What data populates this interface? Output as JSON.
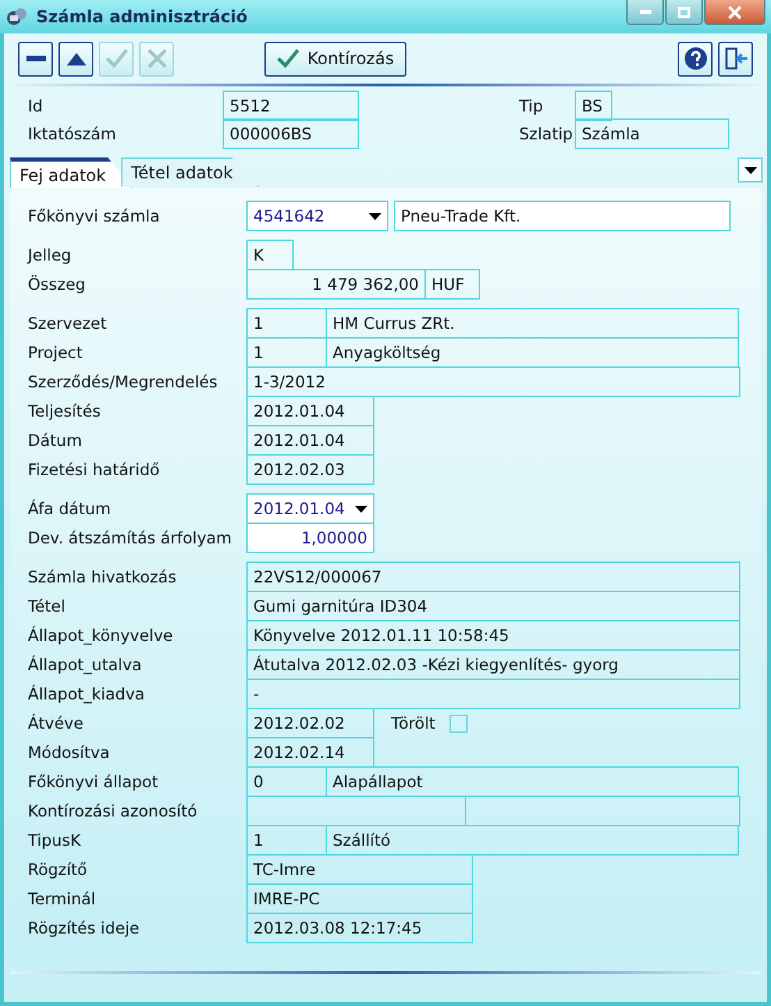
{
  "window": {
    "title": "Számla adminisztráció"
  },
  "toolbar": {
    "left_buttons": [
      {
        "kind": "minus",
        "disabled": false
      },
      {
        "kind": "up",
        "disabled": false
      },
      {
        "kind": "check",
        "disabled": true
      },
      {
        "kind": "cross",
        "disabled": true
      }
    ],
    "center_button": {
      "label": "Kontírozás",
      "disabled": false
    },
    "right_buttons": [
      {
        "kind": "help",
        "disabled": false
      },
      {
        "kind": "exit",
        "disabled": false
      }
    ]
  },
  "header": {
    "left": [
      {
        "label": "Id",
        "value": "5512"
      },
      {
        "label": "Iktatószám",
        "value": "000006BS"
      }
    ],
    "right": [
      {
        "label": "Tip",
        "value": "BS",
        "kind": "short"
      },
      {
        "label": "Szlatip",
        "value": "Számla",
        "kind": "wide"
      }
    ]
  },
  "tabs": [
    {
      "label": "Fej adatok",
      "selected": true
    },
    {
      "label": "Tétel adatok",
      "selected": false
    }
  ],
  "form": {
    "groups": [
      [
        {
          "label": "Főkönyvi számla",
          "kind": "combo-text",
          "editable": true,
          "values": [
            "4541642",
            "Pneu-Trade Kft."
          ]
        }
      ],
      [
        {
          "label": "Jelleg",
          "kind": "short",
          "editable": false,
          "values": [
            "K"
          ]
        },
        {
          "label": "Összeg",
          "kind": "amount",
          "editable": false,
          "values": [
            "1 479 362,00",
            "HUF"
          ]
        }
      ],
      [
        {
          "label": "Szervezet",
          "kind": "pair",
          "editable": false,
          "values": [
            "1",
            "HM Currus ZRt."
          ]
        },
        {
          "label": "Project",
          "kind": "pair",
          "editable": false,
          "values": [
            "1",
            "Anyagköltség"
          ]
        },
        {
          "label": "Szerződés/Megrendelés",
          "kind": "wide",
          "editable": false,
          "values": [
            "1-3/2012"
          ]
        },
        {
          "label": "Teljesítés",
          "kind": "date",
          "editable": false,
          "values": [
            "2012.01.04"
          ]
        },
        {
          "label": "Dátum",
          "kind": "date",
          "editable": false,
          "values": [
            "2012.01.04"
          ]
        },
        {
          "label": "Fizetési határidő",
          "kind": "date",
          "editable": false,
          "values": [
            "2012.02.03"
          ]
        }
      ],
      [
        {
          "label": "Áfa dátum",
          "kind": "combo",
          "editable": true,
          "values": [
            "2012.01.04"
          ]
        },
        {
          "label": "Dev. átszámítás árfolyam",
          "kind": "number",
          "editable": true,
          "values": [
            "1,00000"
          ]
        }
      ],
      [
        {
          "label": "Számla hivatkozás",
          "kind": "wide",
          "editable": false,
          "values": [
            "22VS12/000067"
          ]
        },
        {
          "label": "Tétel",
          "kind": "wide",
          "editable": false,
          "values": [
            "Gumi garnitúra ID304"
          ]
        },
        {
          "label": "Állapot_könyvelve",
          "kind": "wide",
          "editable": false,
          "values": [
            "Könyvelve 2012.01.11 10:58:45"
          ]
        },
        {
          "label": "Állapot_utalva",
          "kind": "wide",
          "editable": false,
          "values": [
            "Átutalva 2012.02.03 -Kézi kiegyenlítés- gyorg"
          ]
        },
        {
          "label": "Állapot_kiadva",
          "kind": "wide",
          "editable": false,
          "values": [
            "-"
          ]
        },
        {
          "label": "Átvéve",
          "kind": "date-check",
          "editable": false,
          "values": [
            "2012.02.02"
          ],
          "checkbox": {
            "label": "Törölt",
            "checked": false
          }
        },
        {
          "label": "Módosítva",
          "kind": "date",
          "editable": false,
          "values": [
            "2012.02.14"
          ]
        },
        {
          "label": "Főkönyvi állapot",
          "kind": "pair",
          "editable": false,
          "values": [
            "0",
            "Alapállapot"
          ]
        },
        {
          "label": "Kontírozási azonosító",
          "kind": "split",
          "editable": false
        },
        {
          "label": "TipusK",
          "kind": "pair",
          "editable": false,
          "values": [
            "1",
            "Szállító"
          ]
        },
        {
          "label": "Rögzítő",
          "kind": "medium",
          "editable": false,
          "values": [
            "TC-Imre"
          ]
        },
        {
          "label": "Terminál",
          "kind": "medium",
          "editable": false,
          "values": [
            "IMRE-PC"
          ]
        },
        {
          "label": "Rögzítés ideje",
          "kind": "medium",
          "editable": false,
          "values": [
            "2012.03.08 12:17:45"
          ]
        }
      ]
    ]
  }
}
